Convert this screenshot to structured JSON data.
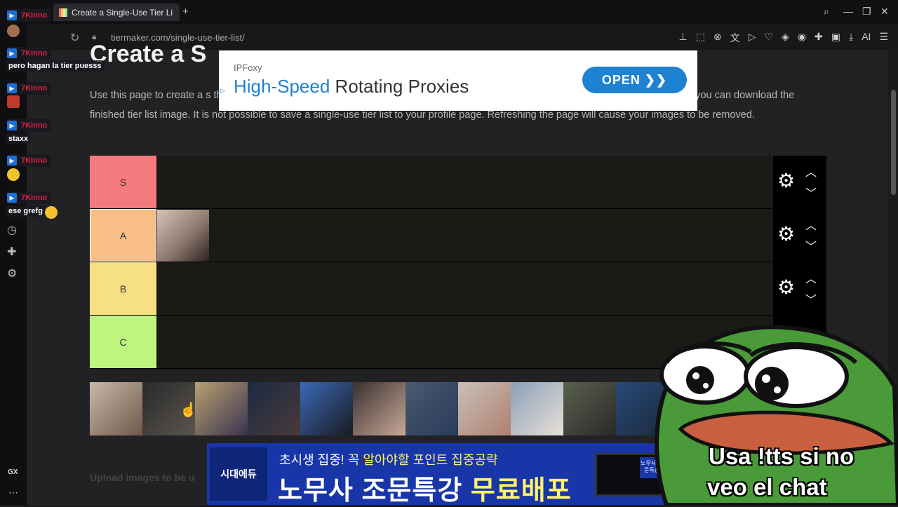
{
  "browser": {
    "tab_title": "Create a Single-Use Tier Li",
    "new_tab": "+",
    "url": "tiermaker.com/single-use-tier-list/",
    "ai_label": "AI",
    "gx_label": "GX"
  },
  "page": {
    "title": "Create a S",
    "description": "Use this page to create a s                                                                                                                                                                          the website. Use the Upload button below the tier list to add your images. Once you have finished your list, you can download the finished tier list image. It is not possible to save a single-use tier list to your profile page. Refreshing the page will cause your images to be removed.",
    "upload_label": "Upload images to be u"
  },
  "tiers": [
    {
      "label": "S",
      "color": "#f47a7e"
    },
    {
      "label": "A",
      "color": "#f7bf86"
    },
    {
      "label": "B",
      "color": "#f7df84"
    },
    {
      "label": "C",
      "color": "#bdf57f"
    }
  ],
  "ad_top": {
    "brand": "IPFoxy",
    "headline_highlight": "High-Speed",
    "headline_rest": " Rotating Proxies",
    "button": "OPEN ❯❯"
  },
  "ad_bottom": {
    "logo": "시대에듀",
    "sub_white": "초시생 집중! ",
    "sub_yellow": "꼭 알아야할 포인트 집중공략",
    "main_white": "노무사 조문특강 ",
    "main_yellow": "무료배포",
    "badge": "노무사 조문특강"
  },
  "chat": [
    {
      "user": "7Kinno",
      "message": ""
    },
    {
      "user": "7Kinno",
      "message": "pero hagan la tier puesss"
    },
    {
      "user": "7Kinno",
      "message": ""
    },
    {
      "user": "7Kinno",
      "message": "staxx"
    },
    {
      "user": "7Kinno",
      "message": ""
    },
    {
      "user": "7Kinno",
      "message": "ese grefg"
    }
  ],
  "overlay": {
    "line1": "Usa !tts si no",
    "line2": "veo el chat"
  },
  "colors": {
    "accent_blue": "#1e82d2",
    "twitch_user": "#e11d48"
  }
}
